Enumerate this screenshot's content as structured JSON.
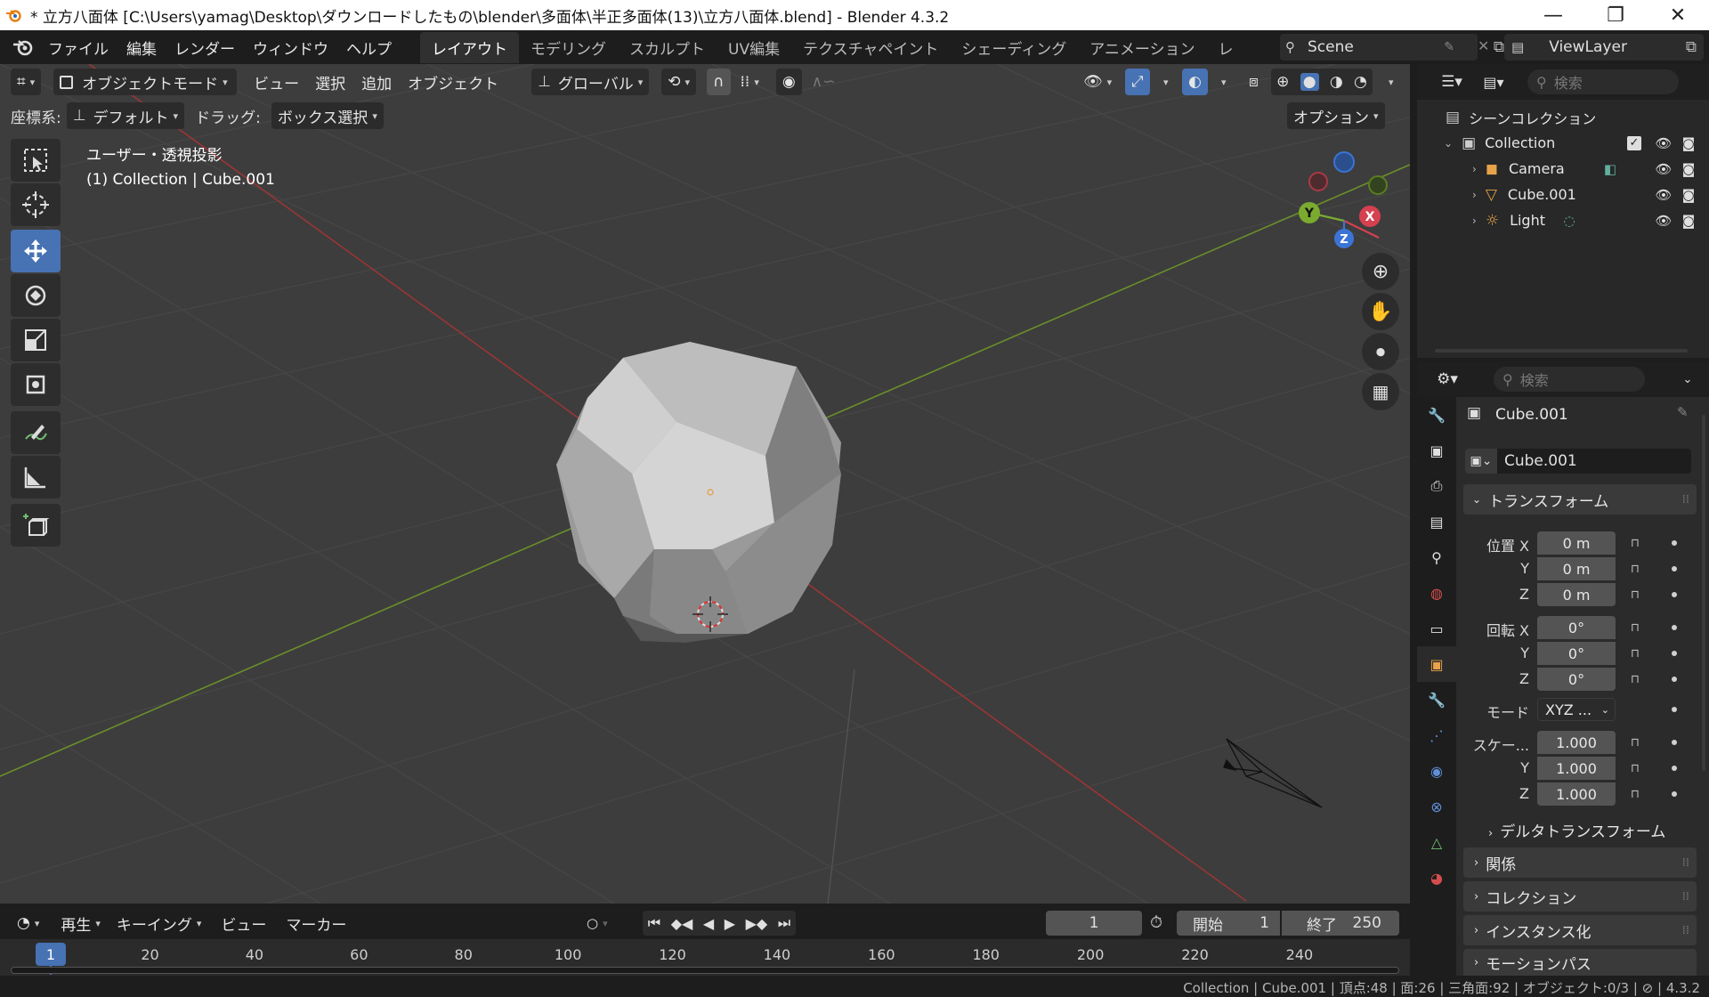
{
  "window": {
    "title": "* 立方八面体 [C:\\Users\\yamag\\Desktop\\ダウンロードしたもの\\blender\\多面体\\半正多面体(13)\\立方八面体.blend] - Blender 4.3.2",
    "minimize": "—",
    "maximize": "❐",
    "close": "✕"
  },
  "menu": {
    "items": [
      "ファイル",
      "編集",
      "レンダー",
      "ウィンドウ",
      "ヘルプ"
    ],
    "workspaces": [
      "レイアウト",
      "モデリング",
      "スカルプト",
      "UV編集",
      "テクスチャペイント",
      "シェーディング",
      "アニメーション",
      "レ"
    ],
    "scene": "Scene",
    "view_layer": "ViewLayer"
  },
  "viewport": {
    "mode": "オブジェクトモード",
    "header_menus": [
      "ビュー",
      "選択",
      "追加",
      "オブジェクト"
    ],
    "transform_orientation": "グローバル",
    "coord_label": "座標系:",
    "coord_value": "デフォルト",
    "drag_label": "ドラッグ:",
    "drag_value": "ボックス選択",
    "options": "オプション",
    "view_name": "ユーザー・透視投影",
    "selection_info": "(1) Collection | Cube.001",
    "gizmo_axes": {
      "x": "X",
      "y": "Y",
      "z": "Z"
    }
  },
  "outliner": {
    "search_placeholder": "検索",
    "scene_collection": "シーンコレクション",
    "collection": "Collection",
    "items": [
      {
        "name": "Camera",
        "icon": "camera-icon",
        "color": "#e8a34a"
      },
      {
        "name": "Cube.001",
        "icon": "mesh-icon",
        "color": "#e8a34a"
      },
      {
        "name": "Light",
        "icon": "light-icon",
        "color": "#e8a34a"
      }
    ]
  },
  "properties": {
    "search_placeholder": "検索",
    "object_name_header": "Cube.001",
    "object_name_field": "Cube.001",
    "transform_section": "トランスフォーム",
    "location_label": "位置 X",
    "rotation_label": "回転 X",
    "scale_label": "スケー...",
    "axis_y": "Y",
    "axis_z": "Z",
    "location": [
      "0 m",
      "0 m",
      "0 m"
    ],
    "rotation": [
      "0°",
      "0°",
      "0°"
    ],
    "mode_label": "モード",
    "mode_value": "XYZ ...",
    "scale": [
      "1.000",
      "1.000",
      "1.000"
    ],
    "delta_transform": "デルタトランスフォーム",
    "sections": [
      "関係",
      "コレクション",
      "インスタンス化",
      "モーションパス"
    ]
  },
  "timeline": {
    "menus": [
      "再生",
      "キーイング",
      "ビュー",
      "マーカー"
    ],
    "current_frame": "1",
    "start_label": "開始",
    "start_value": "1",
    "end_label": "終了",
    "end_value": "250",
    "ticks": [
      "1",
      "20",
      "40",
      "60",
      "80",
      "100",
      "120",
      "140",
      "160",
      "180",
      "200",
      "220",
      "240"
    ]
  },
  "status": {
    "text": "Collection | Cube.001 | 頂点:48 | 面:26 | 三角面:92 | オブジェクト:0/3 | ⊘ | 4.3.2"
  },
  "colors": {
    "accent": "#4772b3",
    "x_axis": "#d6404f",
    "y_axis": "#7aab2f",
    "z_axis": "#3b74d6",
    "object_orange": "#e8a34a"
  }
}
